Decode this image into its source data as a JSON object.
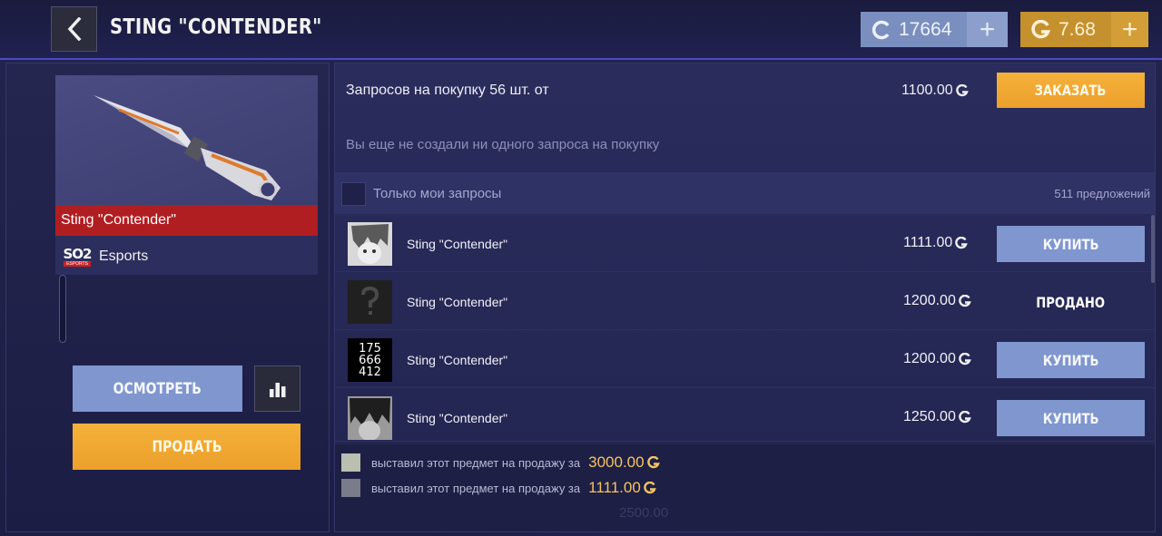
{
  "header": {
    "title": "STING \"CONTENDER\"",
    "silver_balance": "17664",
    "gold_balance": "7.68",
    "plus_label": "+"
  },
  "item": {
    "name": "Sting \"Contender\"",
    "collection_logo_text": "SO2",
    "collection_logo_sub": "ESPORTS",
    "collection": "Esports",
    "inspect_label": "ОСМОТРЕТЬ",
    "sell_label": "ПРОДАТЬ"
  },
  "requests": {
    "summary": "Запросов на покупку 56 шт. от",
    "min_price": "1100.00",
    "order_label": "ЗАКАЗАТЬ",
    "empty_text": "Вы еще не создали ни одного запроса на покупку"
  },
  "filter": {
    "label": "Только мои запросы",
    "offers_count": "511 предложений"
  },
  "listings": [
    {
      "name": "Sting \"Contender\"",
      "price": "1111.00",
      "action": "КУПИТЬ",
      "sold": false,
      "avatar": "anime-avatar"
    },
    {
      "name": "Sting \"Contender\"",
      "price": "1200.00",
      "action": "ПРОДАНО",
      "sold": true,
      "avatar": "question-avatar"
    },
    {
      "name": "Sting \"Contender\"",
      "price": "1200.00",
      "action": "КУПИТЬ",
      "sold": false,
      "avatar": "text-avatar",
      "avatar_text": [
        "175",
        "666",
        "412"
      ]
    },
    {
      "name": "Sting \"Contender\"",
      "price": "1250.00",
      "action": "КУПИТЬ",
      "sold": false,
      "avatar": "anime-avatar"
    }
  ],
  "feed": [
    {
      "text": "выставил этот предмет на продажу за",
      "amount": "3000.00"
    },
    {
      "text": "выставил этот предмет на продажу за",
      "amount": "1111.00"
    }
  ],
  "feed_ghost": "2500.00",
  "colors": {
    "accent_orange": "#eba02c",
    "button_blue": "#7f96cf",
    "item_rarity_red": "#b01e22",
    "gold_text": "#f5c462"
  }
}
